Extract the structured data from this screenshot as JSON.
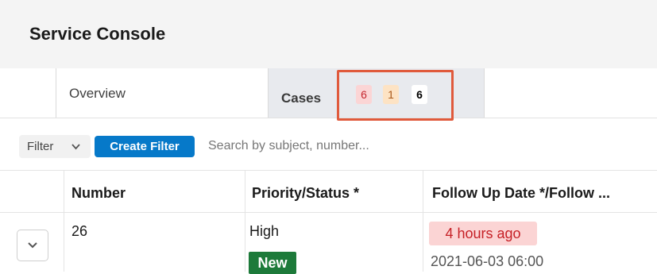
{
  "header": {
    "title": "Service Console"
  },
  "tabs": [
    {
      "label": "Overview"
    },
    {
      "label": "Cases",
      "badges": [
        "6",
        "1",
        "6"
      ]
    }
  ],
  "filterbar": {
    "filter_label": "Filter",
    "create_filter_label": "Create Filter",
    "search_placeholder": "Search by subject, number..."
  },
  "table": {
    "columns": [
      "Number",
      "Priority/Status *",
      "Follow Up Date */Follow ..."
    ],
    "rows": [
      {
        "number": "26",
        "priority": "High",
        "status": "New",
        "follow_up_relative": "4 hours ago",
        "follow_up_date": "2021-06-03 06:00"
      }
    ]
  },
  "colors": {
    "accent": "#0679c9",
    "status_new": "#1d7a3a",
    "overdue_bg": "#fbd4d4",
    "highlight_box": "#e05a3c"
  }
}
